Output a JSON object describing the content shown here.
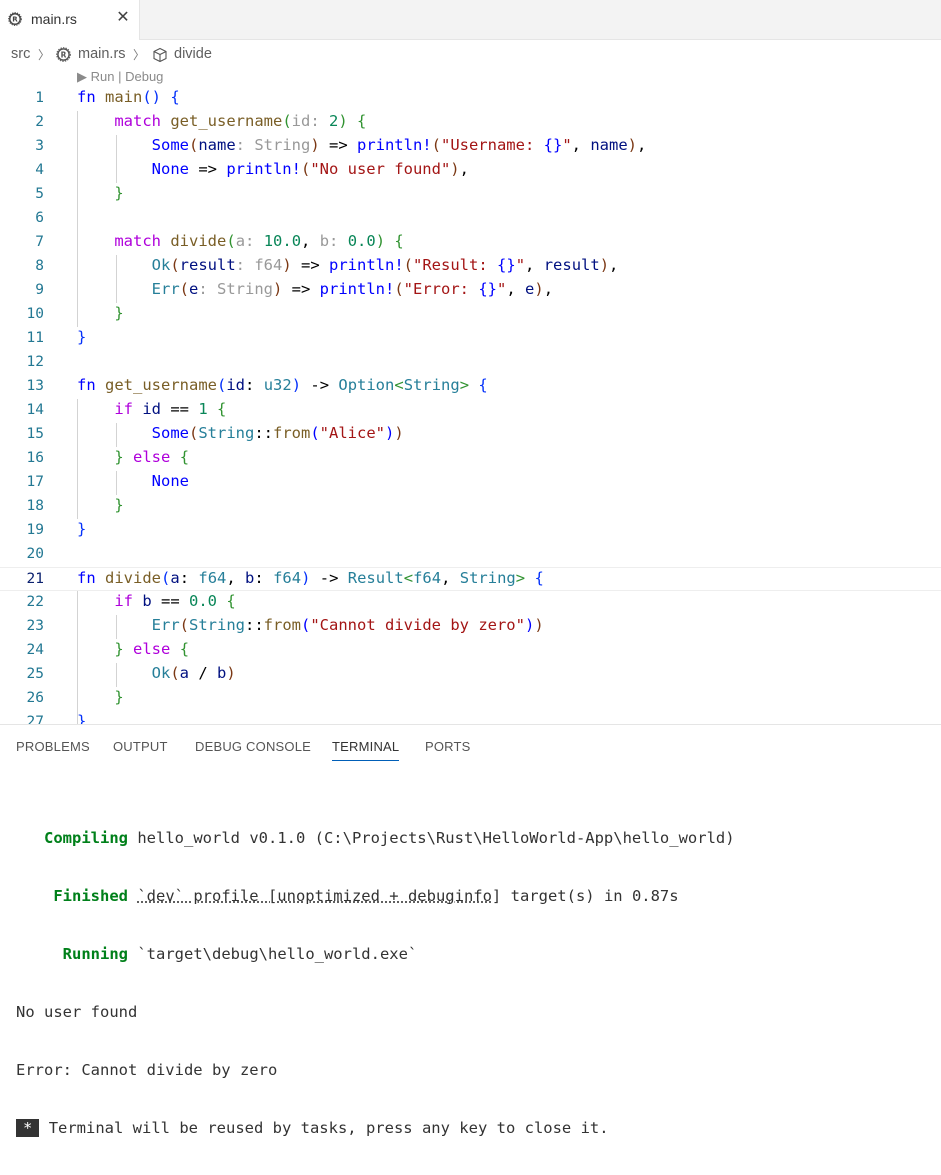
{
  "tab": {
    "label": "main.rs",
    "icon": "rust-icon",
    "close_icon": "close-icon"
  },
  "breadcrumb": {
    "items": [
      "src",
      "main.rs",
      "divide"
    ]
  },
  "codelens": {
    "run": "Run",
    "debug": "Debug"
  },
  "panel": {
    "tabs": [
      "PROBLEMS",
      "OUTPUT",
      "DEBUG CONSOLE",
      "TERMINAL",
      "PORTS"
    ],
    "active_tab": "TERMINAL"
  },
  "terminal": {
    "compiling_label": "Compiling",
    "compiling_text": "hello_world v0.1.0 (C:\\Projects\\Rust\\HelloWorld-App\\hello_world)",
    "finished_label": "Finished",
    "finished_profile": "`dev` profile [unoptimized + debuginfo]",
    "finished_rest": "target(s) in 0.87s",
    "running_label": "Running",
    "running_text": "`target\\debug\\hello_world.exe`",
    "output1": "No user found",
    "output2": "Error: Cannot divide by zero",
    "badge": "*",
    "reuse_msg": "Terminal will be reused by tasks, press any key to close it."
  },
  "colors": {
    "keyword": "#0000ff",
    "control": "#af00db",
    "function": "#795e26",
    "string": "#a31515",
    "number": "#098658",
    "type": "#267f99",
    "success": "#00801a"
  }
}
